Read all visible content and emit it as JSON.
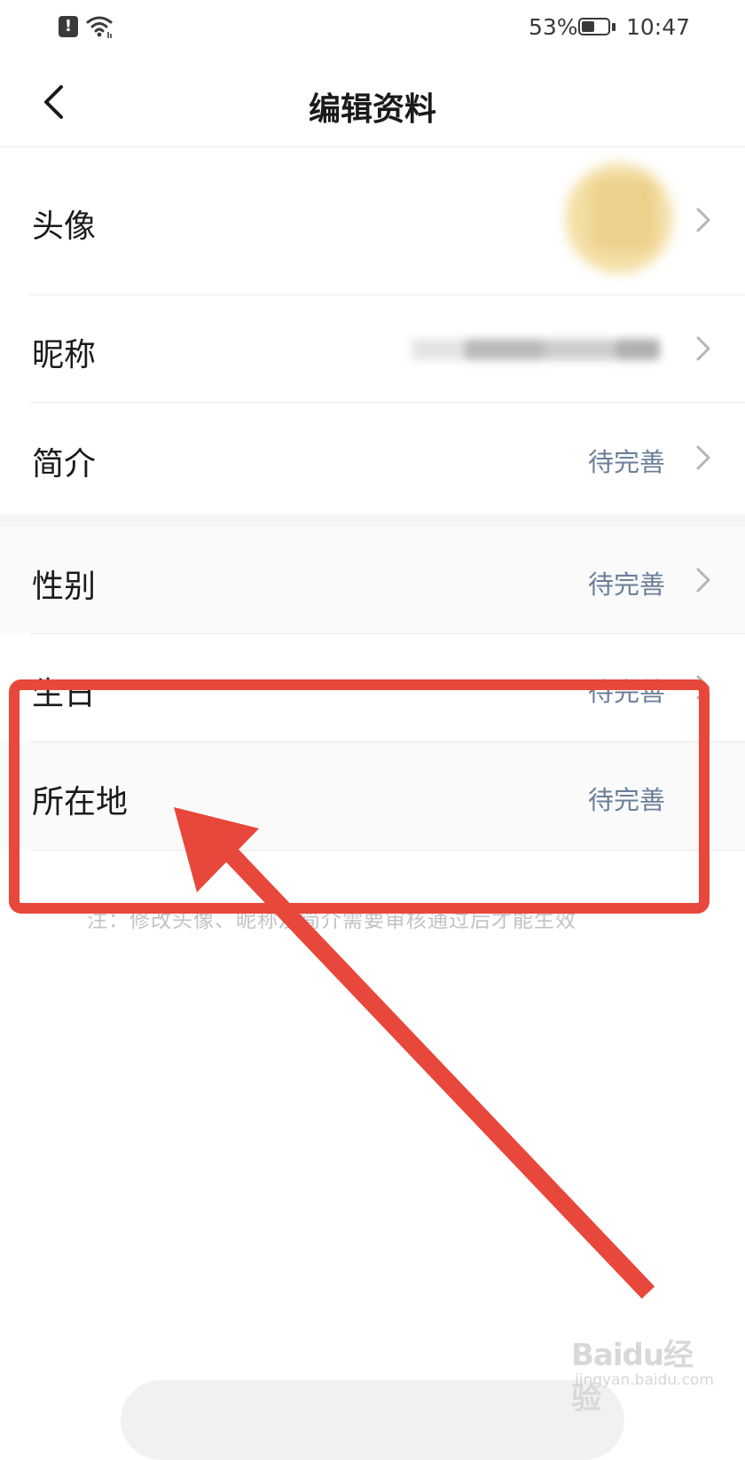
{
  "status_bar": {
    "battery_percent": "53%",
    "time": "10:47",
    "battery_level": 0.53,
    "icons": [
      "alert-icon",
      "wifi-icon",
      "battery-icon"
    ]
  },
  "nav": {
    "title": "编辑资料",
    "back_icon": "chevron-left-icon"
  },
  "rows": [
    {
      "label": "头像",
      "value": "",
      "has_chevron": true
    },
    {
      "label": "昵称",
      "value": "",
      "has_chevron": true
    },
    {
      "label": "简介",
      "value": "待完善",
      "has_chevron": true
    },
    {
      "label": "性别",
      "value": "待完善",
      "has_chevron": true
    },
    {
      "label": "生日",
      "value": "待完善",
      "has_chevron": true
    },
    {
      "label": "所在地",
      "value": "待完善",
      "has_chevron": false
    }
  ],
  "note": "注：修改头像、昵称及简介需要审核通过后才能生效",
  "watermark": {
    "logo": "Baidu经验",
    "url": "jingyan.baidu.com"
  },
  "colors": {
    "value_text": "#6b7f99",
    "annotation_red": "#e8473b",
    "divider": "#e8e8e8"
  }
}
